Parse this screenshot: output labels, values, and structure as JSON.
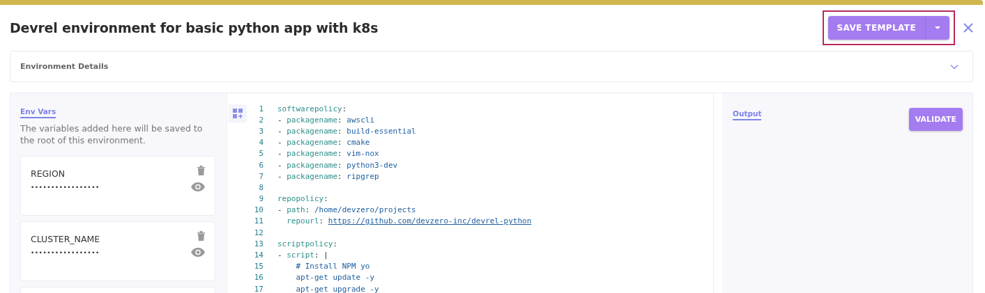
{
  "dialog": {
    "title": "Devrel environment for basic python app with k8s"
  },
  "save_button": {
    "label": "SAVE TEMPLATE",
    "highlighted": true
  },
  "details_panel": {
    "label": "Environment Details",
    "expanded": false
  },
  "env_vars": {
    "tab": "Env Vars",
    "description": "The variables added here will be saved to the root of this environment.",
    "items": [
      {
        "name": "REGION",
        "value": "•••••••••••••••••"
      },
      {
        "name": "CLUSTER_NAME",
        "value": "•••••••••••••••••"
      }
    ]
  },
  "editor": {
    "lines": [
      {
        "number": "1",
        "parts": [
          {
            "kind": "key",
            "text": "softwarepolicy"
          },
          {
            "kind": "punct",
            "text": ":"
          }
        ]
      },
      {
        "number": "2",
        "parts": [
          {
            "kind": "punct",
            "text": "- "
          },
          {
            "kind": "key",
            "text": "packagename"
          },
          {
            "kind": "punct",
            "text": ": "
          },
          {
            "kind": "value",
            "text": "awscli"
          }
        ]
      },
      {
        "number": "3",
        "parts": [
          {
            "kind": "punct",
            "text": "- "
          },
          {
            "kind": "key",
            "text": "packagename"
          },
          {
            "kind": "punct",
            "text": ": "
          },
          {
            "kind": "value",
            "text": "build-essential"
          }
        ]
      },
      {
        "number": "4",
        "parts": [
          {
            "kind": "punct",
            "text": "- "
          },
          {
            "kind": "key",
            "text": "packagename"
          },
          {
            "kind": "punct",
            "text": ": "
          },
          {
            "kind": "value",
            "text": "cmake"
          }
        ]
      },
      {
        "number": "5",
        "parts": [
          {
            "kind": "punct",
            "text": "- "
          },
          {
            "kind": "key",
            "text": "packagename"
          },
          {
            "kind": "punct",
            "text": ": "
          },
          {
            "kind": "value",
            "text": "vim-nox"
          }
        ]
      },
      {
        "number": "6",
        "parts": [
          {
            "kind": "punct",
            "text": "- "
          },
          {
            "kind": "key",
            "text": "packagename"
          },
          {
            "kind": "punct",
            "text": ": "
          },
          {
            "kind": "value",
            "text": "python3-dev"
          }
        ]
      },
      {
        "number": "7",
        "parts": [
          {
            "kind": "punct",
            "text": "- "
          },
          {
            "kind": "key",
            "text": "packagename"
          },
          {
            "kind": "punct",
            "text": ": "
          },
          {
            "kind": "value",
            "text": "ripgrep"
          }
        ]
      },
      {
        "number": "8"
      },
      {
        "number": "9",
        "parts": [
          {
            "kind": "key",
            "text": "repopolicy"
          },
          {
            "kind": "punct",
            "text": ":"
          }
        ]
      },
      {
        "number": "10",
        "parts": [
          {
            "kind": "punct",
            "text": "- "
          },
          {
            "kind": "key",
            "text": "path"
          },
          {
            "kind": "punct",
            "text": ": "
          },
          {
            "kind": "value",
            "text": "/home/devzero/projects"
          }
        ]
      },
      {
        "number": "11",
        "parts": [
          {
            "kind": "key",
            "text": "  repourl"
          },
          {
            "kind": "punct",
            "text": ": "
          },
          {
            "kind": "link",
            "text": "https://github.com/devzero-inc/devrel-python"
          }
        ]
      },
      {
        "number": "12"
      },
      {
        "number": "13",
        "parts": [
          {
            "kind": "key",
            "text": "scriptpolicy"
          },
          {
            "kind": "punct",
            "text": ":"
          }
        ]
      },
      {
        "number": "14",
        "parts": [
          {
            "kind": "punct",
            "text": "- "
          },
          {
            "kind": "key",
            "text": "script"
          },
          {
            "kind": "punct",
            "text": ": |"
          }
        ]
      },
      {
        "number": "15",
        "parts": [
          {
            "kind": "value",
            "text": "    # Install NPM yo"
          }
        ]
      },
      {
        "number": "16",
        "parts": [
          {
            "kind": "value",
            "text": "    apt-get update -y"
          }
        ]
      },
      {
        "number": "17",
        "parts": [
          {
            "kind": "value",
            "text": "    apt-get upgrade -y"
          }
        ]
      }
    ]
  },
  "output": {
    "tab": "Output",
    "validate_button": "VALIDATE"
  }
}
